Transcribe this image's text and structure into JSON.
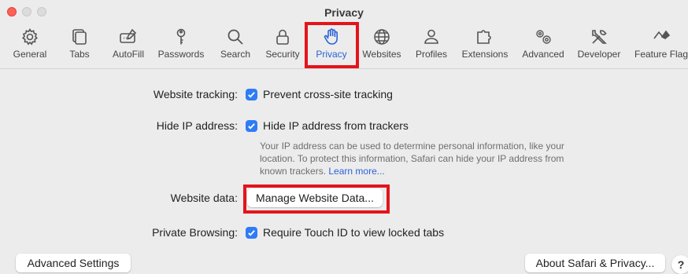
{
  "window": {
    "title": "Privacy"
  },
  "toolbar": {
    "items": [
      {
        "label": "General",
        "icon": "gear-icon"
      },
      {
        "label": "Tabs",
        "icon": "tabs-icon"
      },
      {
        "label": "AutoFill",
        "icon": "autofill-icon"
      },
      {
        "label": "Passwords",
        "icon": "key-icon"
      },
      {
        "label": "Search",
        "icon": "search-icon"
      },
      {
        "label": "Security",
        "icon": "lock-icon"
      },
      {
        "label": "Privacy",
        "icon": "hand-icon",
        "active": true
      },
      {
        "label": "Websites",
        "icon": "globe-icon"
      },
      {
        "label": "Profiles",
        "icon": "person-icon"
      },
      {
        "label": "Extensions",
        "icon": "puzzle-icon"
      },
      {
        "label": "Advanced",
        "icon": "gears-icon"
      },
      {
        "label": "Developer",
        "icon": "tools-icon"
      },
      {
        "label": "Feature Flag",
        "icon": "flags-icon"
      }
    ]
  },
  "privacy": {
    "website_tracking": {
      "label": "Website tracking:",
      "checkbox_label": "Prevent cross-site tracking",
      "checked": true
    },
    "hide_ip": {
      "label": "Hide IP address:",
      "checkbox_label": "Hide IP address from trackers",
      "checked": true,
      "help_text": "Your IP address can be used to determine personal information, like your location. To protect this information, Safari can hide your IP address from known trackers.",
      "learn_more": "Learn more..."
    },
    "website_data": {
      "label": "Website data:",
      "button": "Manage Website Data..."
    },
    "private_browsing": {
      "label": "Private Browsing:",
      "checkbox_label": "Require Touch ID to view locked tabs",
      "checked": true
    }
  },
  "footer": {
    "advanced_settings": "Advanced Settings",
    "about": "About Safari & Privacy...",
    "help": "?"
  },
  "colors": {
    "accent": "#2e7cf6",
    "highlight": "#e3141c",
    "active_label": "#2a62d9"
  }
}
